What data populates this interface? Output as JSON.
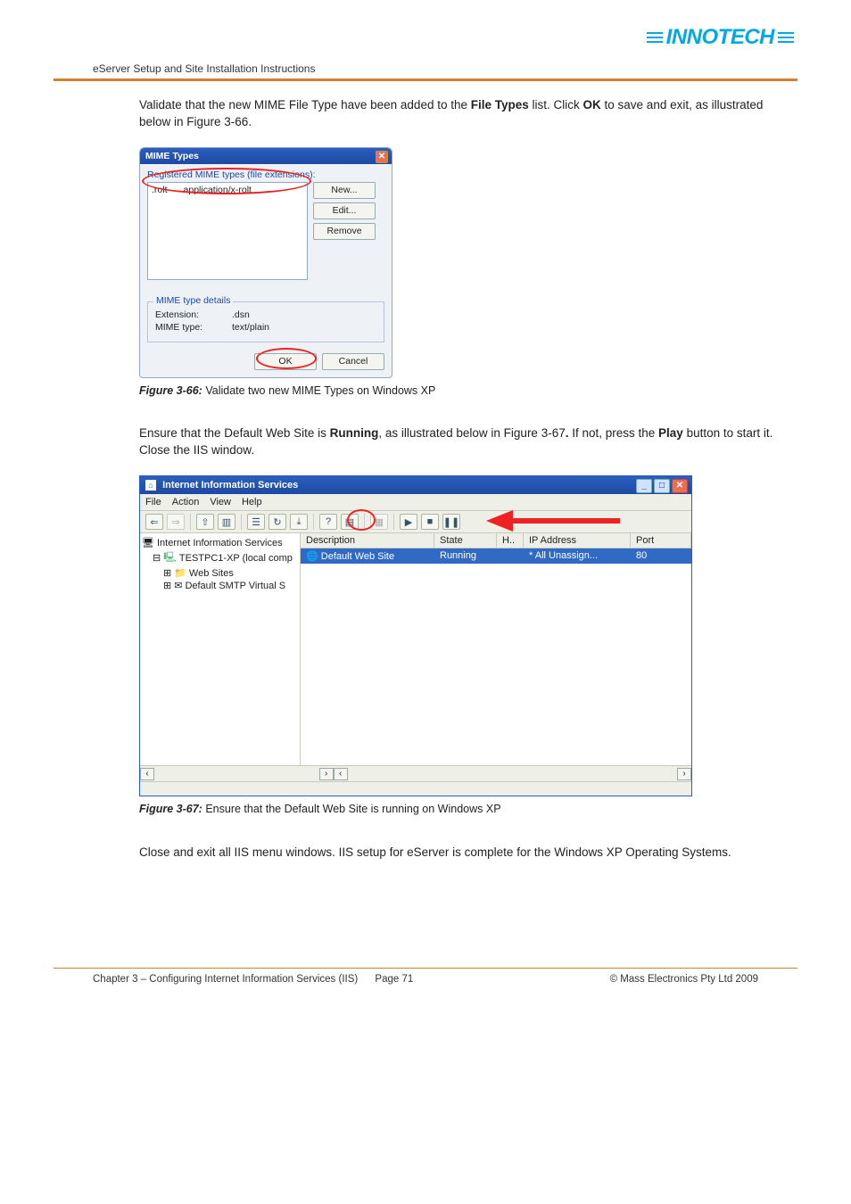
{
  "header": {
    "logo_text": "INNOTECH",
    "subtitle": "eServer Setup and Site Installation Instructions"
  },
  "para1_pre": "Validate that the new MIME File Type have been added to the ",
  "para1_b1": "File Types",
  "para1_mid": " list.  Click ",
  "para1_b2": "OK",
  "para1_post": " to save and exit, as illustrated below in Figure 3-66.",
  "mime": {
    "title": "MIME Types",
    "registered_label": "Registered MIME types (file extensions):",
    "item_ext": ".rolt",
    "item_type": "application/x-rolt",
    "btn_new": "New...",
    "btn_edit": "Edit...",
    "btn_remove": "Remove",
    "details_legend": "MIME type details",
    "ext_label": "Extension:",
    "ext_value": ".dsn",
    "type_label": "MIME type:",
    "type_value": "text/plain",
    "ok": "OK",
    "cancel": "Cancel"
  },
  "fig66_b": "Figure 3-66:",
  "fig66_t": "   Validate two new MIME Types on Windows XP",
  "para2_pre": "Ensure that the Default Web Site is ",
  "para2_b1": "Running",
  "para2_mid": ", as illustrated below in Figure 3-67",
  "para2_b2": ".",
  "para2_mid2": "  If not, press the ",
  "para2_b3": "Play",
  "para2_post": " button to start it.  Close the IIS window.",
  "iis": {
    "title": "Internet Information Services",
    "menu": {
      "file": "File",
      "action": "Action",
      "view": "View",
      "help": "Help"
    },
    "tree": {
      "root": "Internet Information Services",
      "host": "TESTPC1-XP (local comp",
      "websites": "Web Sites",
      "smtp": "Default SMTP Virtual S"
    },
    "cols": {
      "desc": "Description",
      "state": "State",
      "h": "H..",
      "ip": "IP Address",
      "port": "Port"
    },
    "row": {
      "desc": "Default Web Site",
      "state": "Running",
      "h": "",
      "ip": "* All Unassign...",
      "port": "80"
    }
  },
  "fig67_b": "Figure 3-67:",
  "fig67_t": "   Ensure that the Default Web Site is running on Windows XP",
  "para3": "Close and exit all IIS menu windows.  IIS setup for eServer is complete for the Windows XP Operating Systems.",
  "footer": {
    "left_a": "Chapter 3 – Configuring Internet Information Services (IIS)",
    "left_b": "Page 71",
    "right": "© Mass Electronics Pty Ltd  2009"
  }
}
